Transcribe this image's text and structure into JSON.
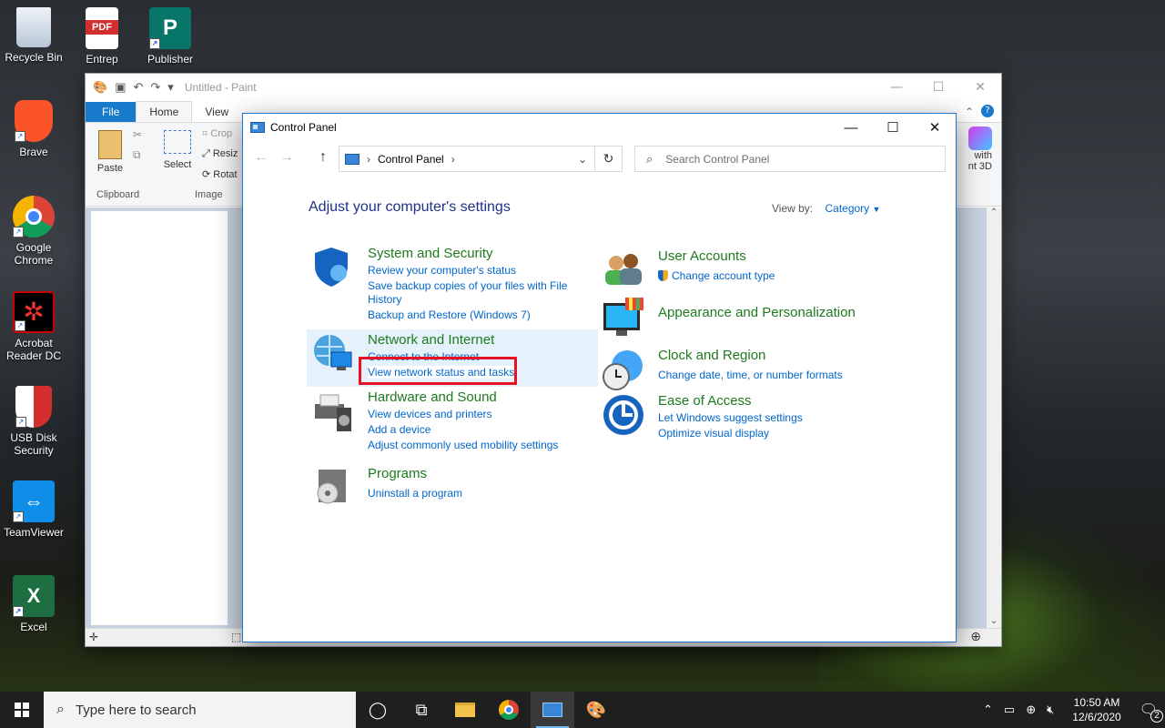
{
  "desktop": {
    "icons": [
      {
        "label": "Recycle Bin"
      },
      {
        "label": "Entrep"
      },
      {
        "label": "Publisher"
      },
      {
        "label": "Brave"
      },
      {
        "label": "Google Chrome"
      },
      {
        "label": "Acrobat Reader DC"
      },
      {
        "label": "USB Disk Security"
      },
      {
        "label": "TeamViewer"
      },
      {
        "label": "Excel"
      }
    ],
    "entrep_badge": "PDF"
  },
  "paint": {
    "title": "Untitled - Paint",
    "tabs": [
      "File",
      "Home",
      "View"
    ],
    "ribbon": {
      "paste": "Paste",
      "clipboard": "Clipboard",
      "select": "Select",
      "crop": "Crop",
      "resize": "Resiz",
      "rotate": "Rotat",
      "image": "Image",
      "paint3d_line1": "with",
      "paint3d_line2": "nt 3D"
    }
  },
  "control_panel": {
    "title": "Control Panel",
    "address": {
      "breadcrumb": "Control Panel",
      "search_placeholder": "Search Control Panel"
    },
    "heading": "Adjust your computer's settings",
    "view_by_label": "View by:",
    "view_by_value": "Category",
    "categories_left": [
      {
        "title": "System and Security",
        "links": [
          "Review your computer's status",
          "Save backup copies of your files with File",
          "History",
          "Backup and Restore (Windows 7)"
        ]
      },
      {
        "title": "Network and Internet",
        "links": [
          "Connect to the Internet",
          "View network status and tasks"
        ]
      },
      {
        "title": "Hardware and Sound",
        "links": [
          "View devices and printers",
          "Add a device",
          "Adjust commonly used mobility settings"
        ]
      },
      {
        "title": "Programs",
        "links": [
          "Uninstall a program"
        ]
      }
    ],
    "categories_right": [
      {
        "title": "User Accounts",
        "links": [
          "Change account type"
        ]
      },
      {
        "title": "Appearance and Personalization",
        "links": []
      },
      {
        "title": "Clock and Region",
        "links": [
          "Change date, time, or number formats"
        ]
      },
      {
        "title": "Ease of Access",
        "links": [
          "Let Windows suggest settings",
          "Optimize visual display"
        ]
      }
    ]
  },
  "taskbar": {
    "search_placeholder": "Type here to search",
    "time": "10:50 AM",
    "date": "12/6/2020",
    "notification_count": "2"
  },
  "colors": {
    "accent": "#0066cc",
    "category_title": "#1e7a1e",
    "heading": "#1e3287",
    "highlight_box": "#e81123"
  }
}
